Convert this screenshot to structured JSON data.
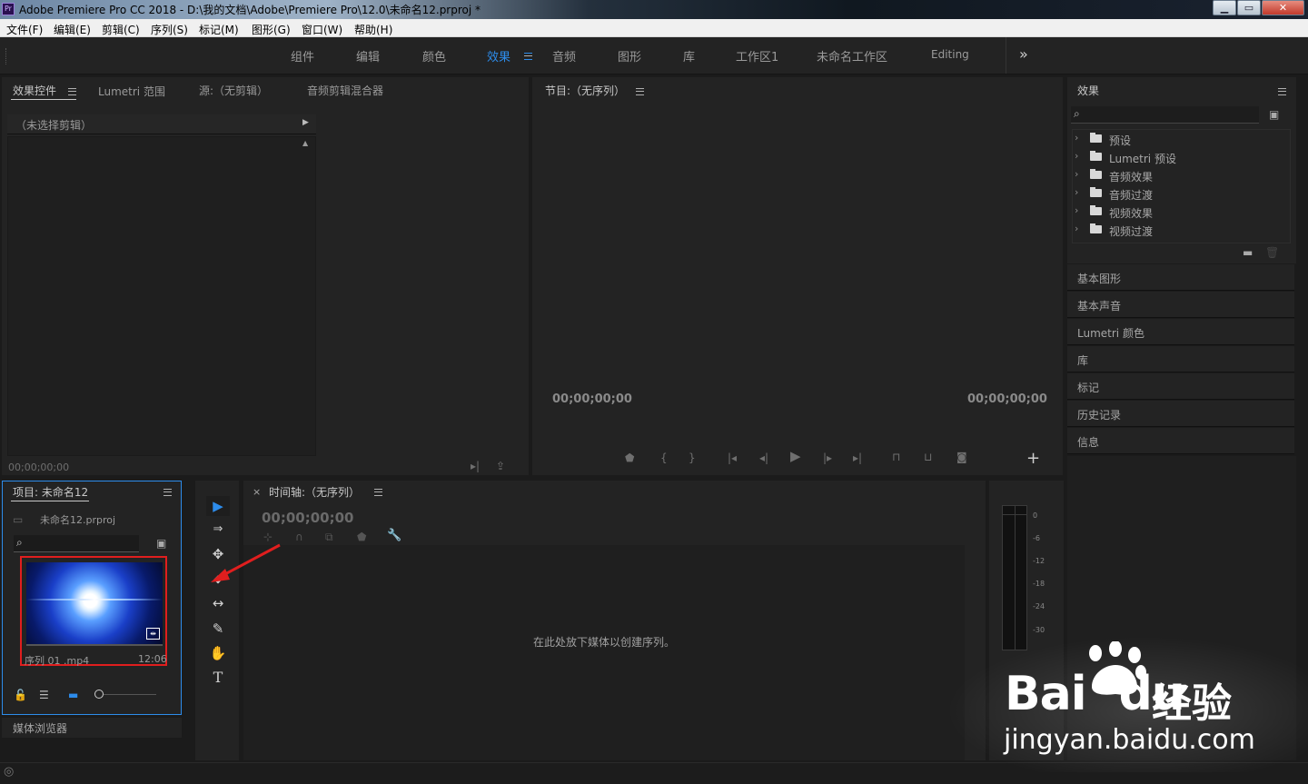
{
  "window": {
    "app_badge": "Pr",
    "title": "Adobe Premiere Pro CC 2018 - D:\\我的文档\\Adobe\\Premiere Pro\\12.0\\未命名12.prproj *",
    "minimize": "▁",
    "maximize": "▭",
    "close": "✕"
  },
  "menu": [
    "文件(F)",
    "编辑(E)",
    "剪辑(C)",
    "序列(S)",
    "标记(M)",
    "图形(G)",
    "窗口(W)",
    "帮助(H)"
  ],
  "workspaces": {
    "tabs": [
      "组件",
      "编辑",
      "颜色",
      "效果",
      "音频",
      "图形",
      "库",
      "工作区1",
      "未命名工作区",
      "Editing"
    ],
    "active_index": 3,
    "overflow": "»",
    "accent_color": "#2d8ceb"
  },
  "source_panel": {
    "tabs": [
      "效果控件",
      "Lumetri 范围",
      "源:（无剪辑）",
      "音频剪辑混合器"
    ],
    "no_clip": "（未选择剪辑）",
    "timecode": "00;00;00;00"
  },
  "program": {
    "title": "节目:（无序列）",
    "timecode_left": "00;00;00;00",
    "timecode_right": "00;00;00;00",
    "add_button": "+"
  },
  "effects": {
    "title": "效果",
    "folders": [
      "预设",
      "Lumetri 预设",
      "音频效果",
      "音频过渡",
      "视频效果",
      "视频过渡"
    ],
    "sections": [
      "基本图形",
      "基本声音",
      "Lumetri 颜色",
      "库",
      "标记",
      "历史记录",
      "信息"
    ]
  },
  "project": {
    "title": "项目: 未命名12",
    "file": "未命名12.prproj",
    "clip_name": "序列 01 .mp4",
    "clip_duration": "12:06",
    "media_browser": "媒体浏览器",
    "highlight_color": "#e01e1e"
  },
  "timeline": {
    "close": "×",
    "title": "时间轴:（无序列）",
    "timecode": "00;00;00;00",
    "drop_hint": "在此处放下媒体以创建序列。"
  },
  "meter_scale": [
    "0",
    "-6",
    "-12",
    "-18",
    "-24",
    "-30"
  ],
  "tools": {
    "selection": "▶",
    "track_select": "⇒",
    "ripple": "✥",
    "razor": "◆",
    "slip": "↔",
    "pen": "✎",
    "hand": "✋",
    "type": "T"
  },
  "watermark": {
    "brand": "Bai",
    "brand_tail": "du",
    "cn": "经验",
    "url": "jingyan.baidu.com"
  }
}
